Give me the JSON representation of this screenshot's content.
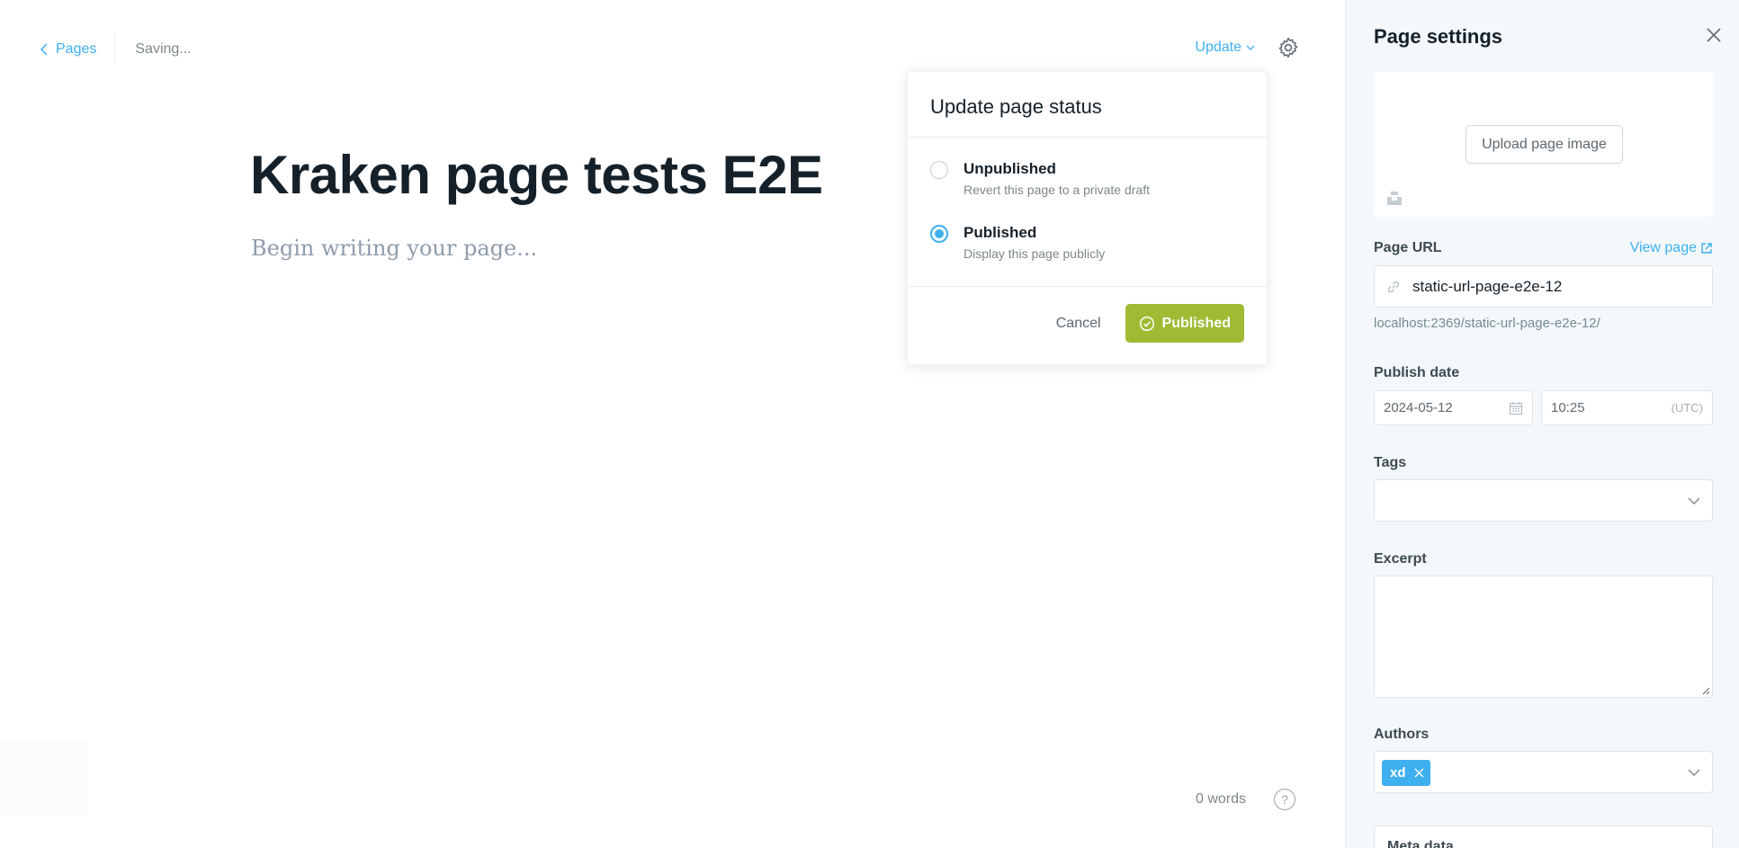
{
  "editor": {
    "back_label": "Pages",
    "status_text": "Saving...",
    "update_label": "Update",
    "title": "Kraken page tests E2E",
    "body_placeholder": "Begin writing your page...",
    "word_count": "0 words",
    "help_label": "?"
  },
  "publish_menu": {
    "heading": "Update page status",
    "options": [
      {
        "label": "Unpublished",
        "description": "Revert this page to a private draft",
        "selected": false
      },
      {
        "label": "Published",
        "description": "Display this page publicly",
        "selected": true
      }
    ],
    "cancel_label": "Cancel",
    "confirm_label": "Published"
  },
  "settings": {
    "title": "Page settings",
    "upload_image_label": "Upload page image",
    "page_url_label": "Page URL",
    "view_page_label": "View page",
    "url_value": "static-url-page-e2e-12",
    "url_preview": "localhost:2369/static-url-page-e2e-12/",
    "publish_date_label": "Publish date",
    "date_value": "2024-05-12",
    "time_value": "10:25",
    "timezone": "(UTC)",
    "tags_label": "Tags",
    "excerpt_label": "Excerpt",
    "authors_label": "Authors",
    "authors": [
      "xd"
    ],
    "meta_data_label": "Meta data"
  },
  "colors": {
    "accent": "#3eb0ef",
    "publish_green": "#9fbb33",
    "title_text": "#15212a",
    "panel_bg": "#f4f8fb"
  }
}
